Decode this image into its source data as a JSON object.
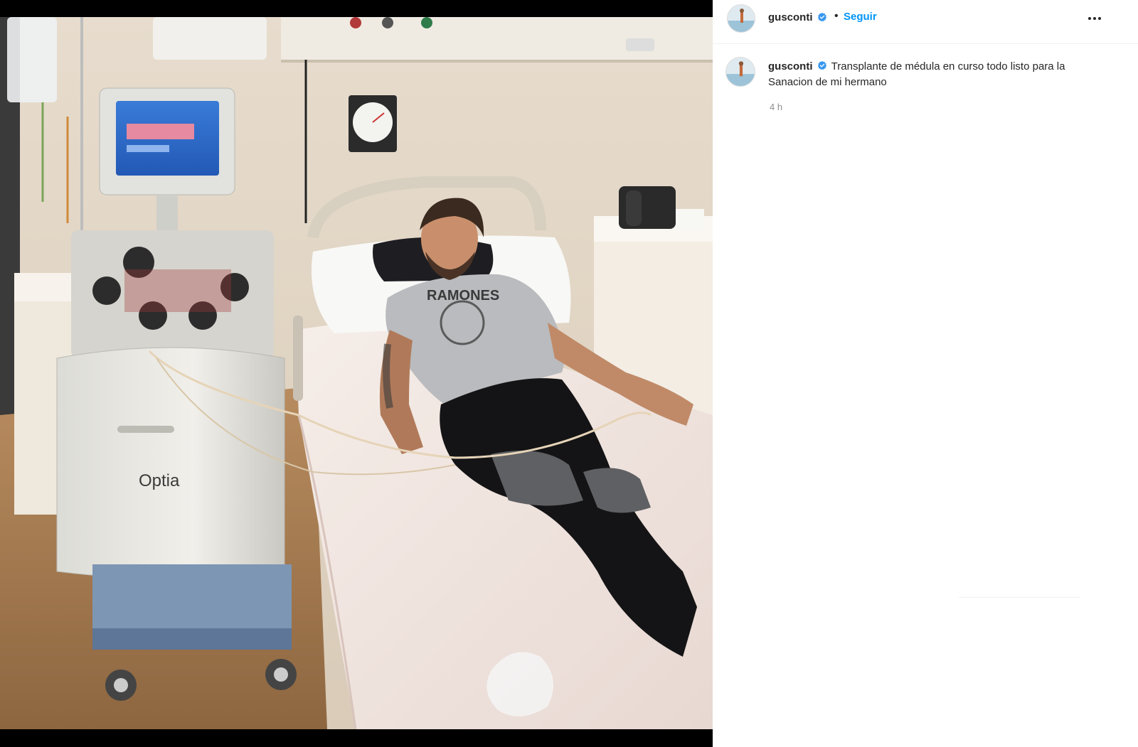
{
  "post": {
    "username": "gusconti",
    "follow_label": "Seguir",
    "separator": "•",
    "caption": "Transplante de médula en curso todo listo para la Sanacion de mi hermano",
    "timestamp": "4 h"
  },
  "photo": {
    "alt": "Hombre sonriendo acostado en una cama de hospital junto a una máquina de aféresis",
    "machine_brand": "Optia",
    "shirt_text": "RAMONES"
  },
  "colors": {
    "accent": "#0095f6",
    "verified": "#3897f0",
    "text": "#262626",
    "muted": "#8e8e8e"
  },
  "icons": {
    "verified": "verified-badge-icon",
    "more": "more-options-icon"
  }
}
